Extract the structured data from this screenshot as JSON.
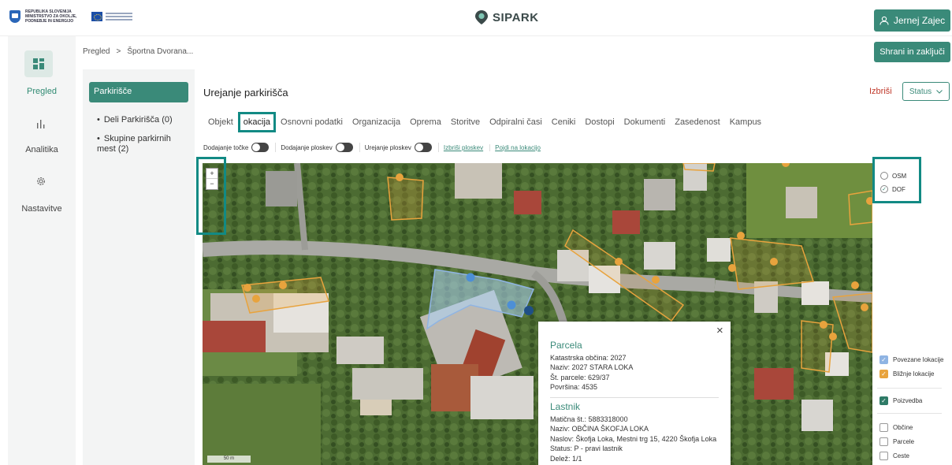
{
  "header": {
    "gov_text": "REPUBLIKA SLOVENIJA MINISTRSTVO ZA OKOLJE, PODNEBJE IN ENERGIJO",
    "brand": "SIPARK",
    "user_name": "Jernej Zajec",
    "brand_color": "#3a8a79"
  },
  "nav": {
    "items": [
      {
        "label": "Pregled",
        "icon": "dashboard-icon"
      },
      {
        "label": "Analitika",
        "icon": "bar-chart-icon"
      },
      {
        "label": "Nastavitve",
        "icon": "gear-icon"
      }
    ]
  },
  "breadcrumb": {
    "root": "Pregled",
    "separator": ">",
    "current": "Športna Dvorana..."
  },
  "actions": {
    "save": "Shrani in zaključi",
    "delete": "Izbriši",
    "status": "Status"
  },
  "parking_panel": {
    "title": "Parkirišče",
    "items": [
      "Deli Parkirišča (0)",
      "Skupine parkirnih mest (2)"
    ]
  },
  "content": {
    "title": "Urejanje parkirišča"
  },
  "tabs": [
    "Objekt",
    "okacija",
    "Osnovni podatki",
    "Organizacija",
    "Oprema",
    "Storitve",
    "Odpiralni časi",
    "Ceniki",
    "Dostopi",
    "Dokumenti",
    "Zasedenost",
    "Kampus"
  ],
  "active_tab": 1,
  "toolbar": {
    "add_point": "Dodajanje točke",
    "add_areas": "Dodajanje ploskev",
    "edit_areas": "Urejanje ploskev",
    "delete_areas": "Izbriši ploskev",
    "go_to_location": "Pojdi na lokacijo"
  },
  "map": {
    "zoom_in": "+",
    "zoom_out": "−",
    "scale": "50 m"
  },
  "layers": {
    "base": [
      {
        "label": "OSM",
        "selected": false
      },
      {
        "label": "DOF",
        "selected": true
      }
    ],
    "overlays": [
      {
        "label": "Povezane lokacije",
        "checked": true,
        "color": "#8fb4e3"
      },
      {
        "label": "Bližnje lokacije",
        "checked": true,
        "color": "#e8a33d"
      },
      {
        "label": "Poizvedba",
        "checked": true,
        "color": "#2f7b67"
      },
      {
        "label": "Občine",
        "checked": false
      },
      {
        "label": "Parcele",
        "checked": false
      },
      {
        "label": "Ceste",
        "checked": false
      }
    ]
  },
  "popup": {
    "parcel_title": "Parcela",
    "parcel_lines": [
      "Katastrska občina: 2027",
      "Naziv: 2027 STARA LOKA",
      "Št. parcele: 629/37",
      "Površina: 4535"
    ],
    "owner_title": "Lastnik",
    "owner_lines": [
      "Matična št.: 5883318000",
      "Naziv: OBČINA ŠKOFJA LOKA",
      "Naslov: Škofja Loka, Mestni trg 15, 4220 Škofja Loka",
      "Status: P - pravi lastnik",
      "Delež: 1/1"
    ],
    "close": "×"
  }
}
